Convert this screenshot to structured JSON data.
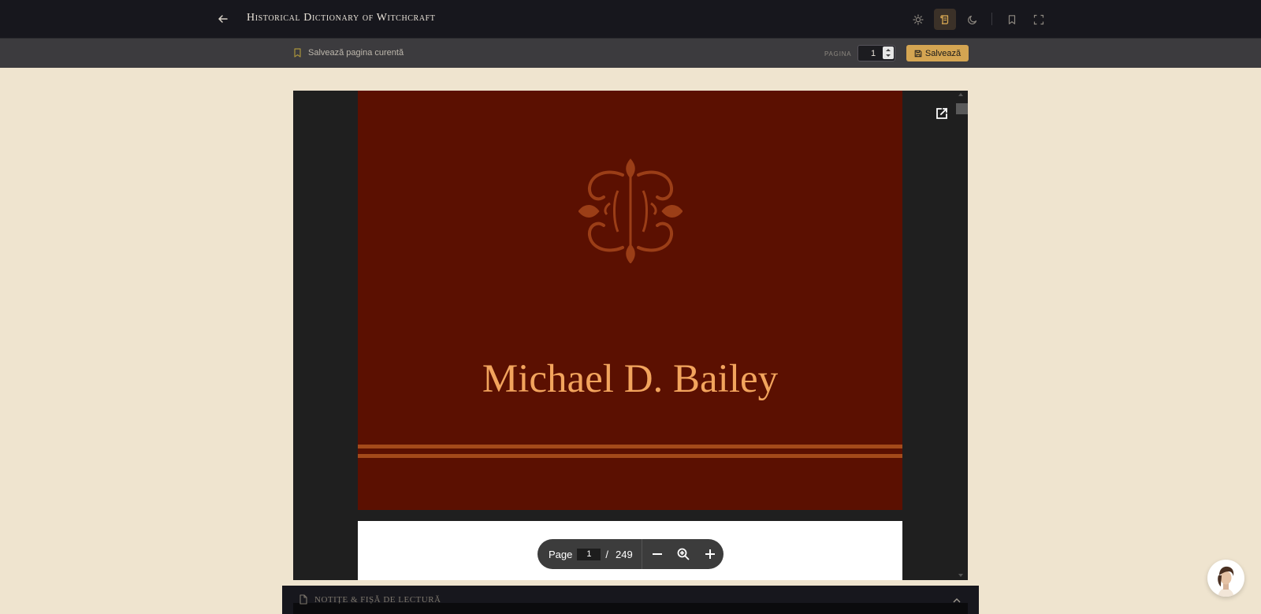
{
  "header": {
    "title": "Historical Dictionary of Witchcraft",
    "tools": [
      {
        "icon": "sun-icon",
        "label": "Light theme"
      },
      {
        "icon": "scroll-icon",
        "label": "Sepia theme",
        "active": true
      },
      {
        "icon": "moon-icon",
        "label": "Dark theme"
      },
      {
        "icon": "bookmark-icon",
        "label": "Bookmark"
      },
      {
        "icon": "fullscreen-icon",
        "label": "Fullscreen"
      }
    ]
  },
  "subbar": {
    "save_page_label": "Salvează pagina curentă",
    "page_label": "PAGINA",
    "page_value": "1",
    "save_button": "Salvează"
  },
  "viewer": {
    "cover_author": "Michael D. Bailey",
    "toolbar": {
      "page_label": "Page",
      "current_page": "1",
      "separator": "/",
      "total_pages": "249"
    }
  },
  "notes": {
    "label": "NOTIȚE & FIȘĂ DE LECTURĂ"
  },
  "colors": {
    "accent": "#d4a552",
    "cover": "#5b1001",
    "cover_text": "#f2a45d",
    "page_bg": "#efe4cf"
  }
}
